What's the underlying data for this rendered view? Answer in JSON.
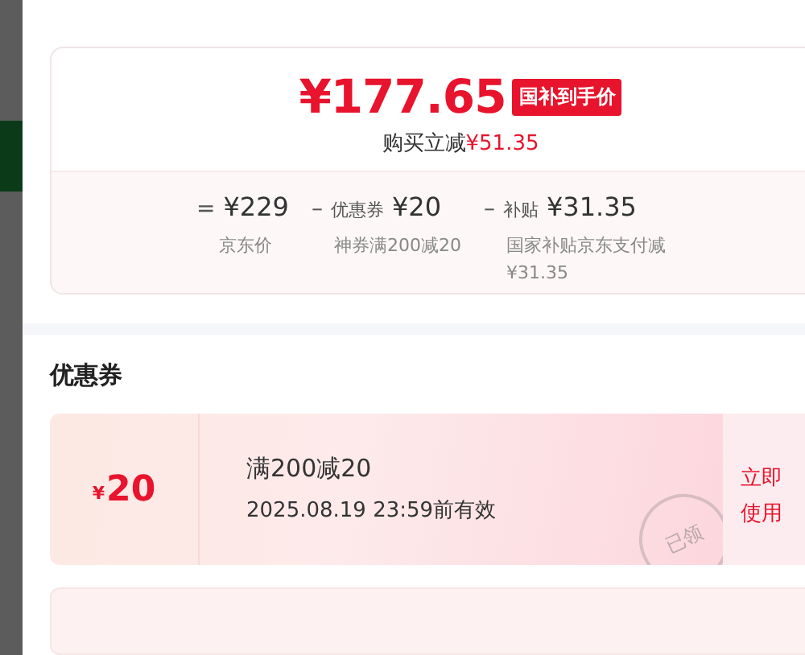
{
  "price_card": {
    "final_price": "¥177.65",
    "badge": "国补到手价",
    "savings_label": "购买立减",
    "savings_amount": "¥51.35",
    "breakdown": [
      {
        "operator": "=",
        "amount": "¥229",
        "note": "京东价"
      },
      {
        "operator": "–",
        "label": "优惠券",
        "amount": "¥20",
        "note": "神券满200减20"
      },
      {
        "operator": "–",
        "label": "补贴",
        "amount": "¥31.35",
        "note": "国家补贴京东支付减¥31.35"
      }
    ]
  },
  "coupons_title": "优惠券",
  "coupons": [
    {
      "kind": "full",
      "value_symbol": "¥",
      "value": "20",
      "condition": "满200减20",
      "validity": "2025.08.19 23:59前有效",
      "action": "立即使用",
      "stamp": "已领"
    },
    {
      "kind": "stub"
    }
  ]
}
